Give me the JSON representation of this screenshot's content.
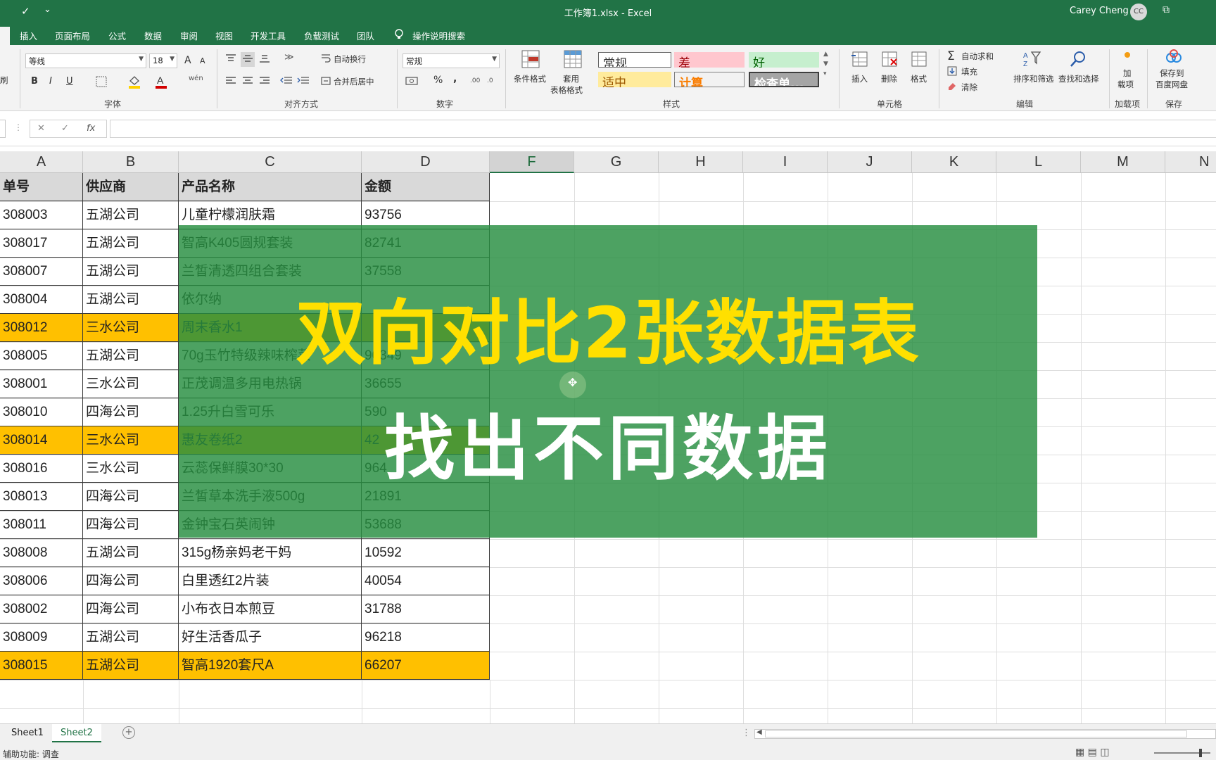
{
  "window": {
    "title": "工作簿1.xlsx  -  Excel",
    "user": "Carey Cheng",
    "user_initials": "CC",
    "quick_access_save": "✓",
    "quick_access_more": "⌄",
    "restore_icon": "⧉"
  },
  "tabs": [
    "插入",
    "页面布局",
    "公式",
    "数据",
    "审阅",
    "视图",
    "开发工具",
    "负载测试",
    "团队"
  ],
  "tell_me": "操作说明搜索",
  "ribbon": {
    "clipboard_fragment": "刷",
    "font": {
      "name": "等线",
      "size": "18",
      "grow": "A",
      "shrink": "A",
      "bold": "B",
      "italic": "I",
      "underline": "U",
      "label": "字体"
    },
    "alignment": {
      "wrap": "自动换行",
      "merge": "合并后居中",
      "label": "对齐方式"
    },
    "number": {
      "format": "常规",
      "percent": "%",
      "comma": ",",
      "label": "数字"
    },
    "styles": {
      "conditional": "条件格式",
      "table_format_1": "套用",
      "table_format_2": "表格格式",
      "normal": "常规",
      "bad": "差",
      "good": "好",
      "neutral": "适中",
      "calc": "计算",
      "check": "检查单...",
      "label": "样式"
    },
    "cells": {
      "insert": "插入",
      "delete": "删除",
      "format": "格式",
      "label": "单元格"
    },
    "editing": {
      "autosum": "自动求和",
      "fill": "填充",
      "clear": "清除",
      "sort": "排序和筛选",
      "find": "查找和选择",
      "label": "编辑"
    },
    "addins": {
      "btn_1": "加",
      "btn_2": "载项",
      "label": "加载项"
    },
    "save": {
      "btn_1": "保存到",
      "btn_2": "百度网盘",
      "label": "保存"
    }
  },
  "formula_bar": {
    "cancel": "✕",
    "enter": "✓",
    "fx": "fx",
    "value": ""
  },
  "columns": [
    "A",
    "B",
    "C",
    "D",
    "F",
    "G",
    "H",
    "I",
    "J",
    "K",
    "L",
    "M",
    "N"
  ],
  "selected_column": "F",
  "table": {
    "headers": [
      "单号",
      "供应商",
      "产品名称",
      "金额"
    ],
    "rows": [
      {
        "id": "308003",
        "supplier": "五湖公司",
        "product": "儿童柠檬润肤霜",
        "amount": "93756",
        "highlight": false
      },
      {
        "id": "308017",
        "supplier": "五湖公司",
        "product": "智高K405圆规套装",
        "amount": "82741",
        "highlight": false
      },
      {
        "id": "308007",
        "supplier": "五湖公司",
        "product": "兰皙清透四组合套装",
        "amount": "37558",
        "highlight": false
      },
      {
        "id": "308004",
        "supplier": "五湖公司",
        "product": "依尔纳",
        "amount": "",
        "highlight": false
      },
      {
        "id": "308012",
        "supplier": "三水公司",
        "product": "周末香水1",
        "amount": "",
        "highlight": true
      },
      {
        "id": "308005",
        "supplier": "五湖公司",
        "product": "70g玉竹特级辣味榨菜",
        "amount": "90349",
        "highlight": false
      },
      {
        "id": "308001",
        "supplier": "三水公司",
        "product": "正茂调温多用电热锅",
        "amount": "36655",
        "highlight": false
      },
      {
        "id": "308010",
        "supplier": "四海公司",
        "product": "1.25升白雪可乐",
        "amount": "590",
        "highlight": false
      },
      {
        "id": "308014",
        "supplier": "三水公司",
        "product": "惠友卷纸2",
        "amount": "42",
        "highlight": true
      },
      {
        "id": "308016",
        "supplier": "三水公司",
        "product": "云蕊保鲜膜30*30",
        "amount": "964",
        "highlight": false
      },
      {
        "id": "308013",
        "supplier": "四海公司",
        "product": "兰皙草本洗手液500g",
        "amount": "21891",
        "highlight": false
      },
      {
        "id": "308011",
        "supplier": "四海公司",
        "product": "金钟宝石英闹钟",
        "amount": "53688",
        "highlight": false
      },
      {
        "id": "308008",
        "supplier": "五湖公司",
        "product": "315g杨亲妈老干妈",
        "amount": "10592",
        "highlight": false
      },
      {
        "id": "308006",
        "supplier": "四海公司",
        "product": "白里透红2片装",
        "amount": "40054",
        "highlight": false
      },
      {
        "id": "308002",
        "supplier": "四海公司",
        "product": "小布衣日本煎豆",
        "amount": "31788",
        "highlight": false
      },
      {
        "id": "308009",
        "supplier": "五湖公司",
        "product": "好生活香瓜子",
        "amount": "96218",
        "highlight": false
      },
      {
        "id": "308015",
        "supplier": "五湖公司",
        "product": "智高1920套尺A",
        "amount": "66207",
        "highlight": true
      }
    ]
  },
  "overlay": {
    "title": "双向对比2张数据表",
    "subtitle": "找出不同数据"
  },
  "sheets": [
    "Sheet1",
    "Sheet2"
  ],
  "active_sheet": "Sheet2",
  "add_sheet": "+",
  "status": {
    "accessibility": "辅助功能: 调查",
    "view_icons": "▦  ▤  ◫"
  },
  "colors": {
    "excel_green": "#217346",
    "highlight_row": "#ffc000",
    "overlay_green": "#268e40",
    "overlay_title": "#ffe000"
  }
}
